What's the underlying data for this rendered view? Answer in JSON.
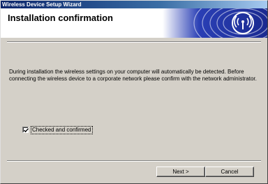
{
  "window": {
    "title": "Wireless Device Setup Wizard"
  },
  "header": {
    "title": "Installation confirmation",
    "logo_icon": "wireless-signal-icon",
    "banner_color": "#1f2fa0"
  },
  "message": "During installation the wireless settings on your computer will automatically be detected. Before connecting the wireless device to a corporate network please confirm with the network administrator.",
  "confirm": {
    "label": "Checked and confirmed",
    "checked": true
  },
  "buttons": {
    "next_label": "Next >",
    "cancel_label": "Cancel"
  }
}
